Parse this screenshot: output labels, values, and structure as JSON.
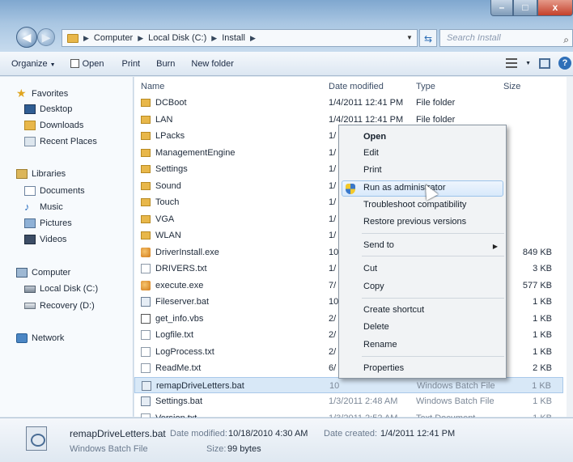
{
  "window": {
    "controls": {
      "minimize": "–",
      "maximize": "□",
      "close": "x"
    }
  },
  "address": {
    "crumbs": [
      "Computer",
      "Local Disk (C:)",
      "Install"
    ],
    "search_placeholder": "Search Install"
  },
  "toolbar": {
    "organize": "Organize",
    "open": "Open",
    "print": "Print",
    "burn": "Burn",
    "new_folder": "New folder"
  },
  "nav": {
    "favorites": "Favorites",
    "desktop": "Desktop",
    "downloads": "Downloads",
    "recent": "Recent Places",
    "libraries": "Libraries",
    "documents": "Documents",
    "music": "Music",
    "pictures": "Pictures",
    "videos": "Videos",
    "computer": "Computer",
    "local_disk": "Local Disk (C:)",
    "recovery": "Recovery (D:)",
    "network": "Network"
  },
  "columns": {
    "name": "Name",
    "date": "Date modified",
    "type": "Type",
    "size": "Size"
  },
  "files": [
    {
      "name": "DCBoot",
      "date": "1/4/2011 12:41 PM",
      "type": "File folder",
      "size": "",
      "icon": "folder"
    },
    {
      "name": "LAN",
      "date": "1/4/2011 12:41 PM",
      "type": "File folder",
      "size": "",
      "icon": "folder"
    },
    {
      "name": "LPacks",
      "date": "1/",
      "type": "",
      "size": "",
      "icon": "folder"
    },
    {
      "name": "ManagementEngine",
      "date": "1/",
      "type": "",
      "size": "",
      "icon": "folder"
    },
    {
      "name": "Settings",
      "date": "1/",
      "type": "",
      "size": "",
      "icon": "folder"
    },
    {
      "name": "Sound",
      "date": "1/",
      "type": "",
      "size": "",
      "icon": "folder"
    },
    {
      "name": "Touch",
      "date": "1/",
      "type": "",
      "size": "",
      "icon": "folder"
    },
    {
      "name": "VGA",
      "date": "1/",
      "type": "",
      "size": "",
      "icon": "folder"
    },
    {
      "name": "WLAN",
      "date": "1/",
      "type": "",
      "size": "",
      "icon": "folder"
    },
    {
      "name": "DriverInstall.exe",
      "date": "10",
      "type": "",
      "size": "849 KB",
      "icon": "exe"
    },
    {
      "name": "DRIVERS.txt",
      "date": "1/",
      "type": "",
      "size": "3 KB",
      "icon": "txt"
    },
    {
      "name": "execute.exe",
      "date": "7/",
      "type": "",
      "size": "577 KB",
      "icon": "exe"
    },
    {
      "name": "Fileserver.bat",
      "date": "10",
      "type": "",
      "size": "1 KB",
      "icon": "bat"
    },
    {
      "name": "get_info.vbs",
      "date": "2/",
      "type": "",
      "size": "1 KB",
      "icon": "vbs"
    },
    {
      "name": "Logfile.txt",
      "date": "2/",
      "type": "",
      "size": "1 KB",
      "icon": "txt"
    },
    {
      "name": "LogProcess.txt",
      "date": "2/",
      "type": "",
      "size": "1 KB",
      "icon": "txt"
    },
    {
      "name": "ReadMe.txt",
      "date": "6/",
      "type": "",
      "size": "2 KB",
      "icon": "txt"
    },
    {
      "name": "remapDriveLetters.bat",
      "date": "10",
      "type": "Windows Batch File",
      "size": "1 KB",
      "icon": "bat",
      "selected": true
    },
    {
      "name": "Settings.bat",
      "date": "1/3/2011 2:48 AM",
      "type": "Windows Batch File",
      "size": "1 KB",
      "icon": "bat"
    },
    {
      "name": "Version.txt",
      "date": "1/3/2011 2:52 AM",
      "type": "Text Document",
      "size": "1 KB",
      "icon": "txt"
    }
  ],
  "context_menu": {
    "open": "Open",
    "edit": "Edit",
    "print": "Print",
    "run_as_admin": "Run as administrator",
    "troubleshoot": "Troubleshoot compatibility",
    "restore": "Restore previous versions",
    "send_to": "Send to",
    "cut": "Cut",
    "copy": "Copy",
    "create_shortcut": "Create shortcut",
    "delete": "Delete",
    "rename": "Rename",
    "properties": "Properties"
  },
  "details": {
    "filename": "remapDriveLetters.bat",
    "date_modified_label": "Date modified:",
    "date_modified": "10/18/2010 4:30 AM",
    "date_created_label": "Date created:",
    "date_created": "1/4/2011 12:41 PM",
    "type": "Windows Batch File",
    "size_label": "Size:",
    "size": "99 bytes"
  }
}
